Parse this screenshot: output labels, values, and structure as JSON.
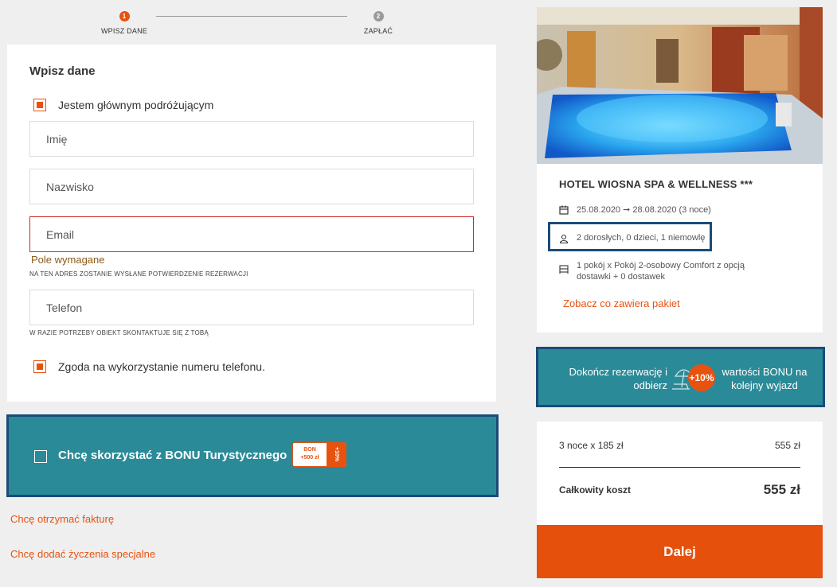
{
  "stepper": {
    "step1_number": "1",
    "step1_label": "WPISZ DANE",
    "step2_number": "2",
    "step2_label": "ZAPŁAĆ"
  },
  "form": {
    "title": "Wpisz dane",
    "main_traveler_label": "Jestem głównym podróżującym",
    "first_name_placeholder": "Imię",
    "last_name_placeholder": "Nazwisko",
    "email_placeholder": "Email",
    "email_error": "Pole wymagane",
    "email_hint": "NA TEN ADRES ZOSTANIE WYSŁANE POTWIERDZENIE REZERWACJI",
    "phone_placeholder": "Telefon",
    "phone_hint": "W RAZIE POTRZEBY OBIEKT SKONTAKTUJE SIĘ Z TOBĄ",
    "phone_consent_label": "Zgoda na wykorzystanie numeru telefonu."
  },
  "bonus": {
    "label": "Chcę skorzystać z BONU Turystycznego",
    "badge_line1": "BON",
    "badge_line2": "+500 zł",
    "badge_side": "+10%"
  },
  "links": {
    "invoice": "Chcę otrzymać fakturę",
    "special_requests": "Chcę dodać życzenia specjalne"
  },
  "hotel": {
    "name": "HOTEL WIOSNA SPA & WELLNESS ***",
    "dates": "25.08.2020 ➞ 28.08.2020 (3 noce)",
    "guests": "2 dorosłych, 0 dzieci, 1 niemowlę",
    "room": "1 pokój x Pokój 2-osobowy Comfort z opcją dostawki + 0 dostawek",
    "package_link": "Zobacz co zawiera pakiet"
  },
  "promo": {
    "left_text": "Dokończ rezerwację i odbierz",
    "badge": "+10%",
    "right_text": "wartości BONU na kolejny wyjazd"
  },
  "price": {
    "nights_label": "3 noce x 185 zł",
    "nights_value": "555 zł",
    "total_label": "Całkowity koszt",
    "total_value": "555 zł",
    "next_button": "Dalej"
  },
  "colors": {
    "accent": "#e8520f",
    "teal": "#2b8a98",
    "highlight_border": "#1b4b78"
  }
}
